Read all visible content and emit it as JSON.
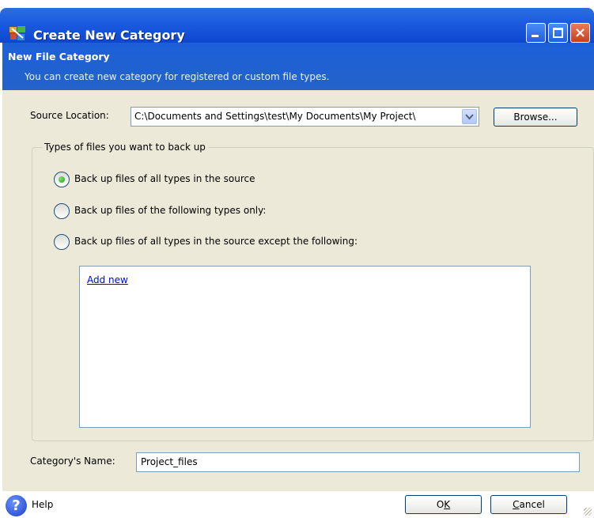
{
  "window": {
    "title": "Create New Category",
    "controls": {
      "minimize": "minimize",
      "maximize": "maximize",
      "close": "×"
    }
  },
  "header": {
    "title": "New File Category",
    "subtitle": "You can create new category for registered or custom file types."
  },
  "source": {
    "label": "Source Location:",
    "value": "C:\\Documents and Settings\\test\\My Documents\\My Project\\",
    "browse_label": "Browse..."
  },
  "filetypes": {
    "legend": "Types of files you want to back up",
    "options": [
      {
        "label": "Back up files of all types in the source",
        "selected": true
      },
      {
        "label": "Back up files of the following types only:",
        "selected": false
      },
      {
        "label": "Back up files of all types in the source except the following:",
        "selected": false
      }
    ],
    "list": {
      "add_link": "Add new"
    }
  },
  "category_name": {
    "label": "Category's Name:",
    "value": "Project_files"
  },
  "footer": {
    "help_label": "Help",
    "ok_label": "OK",
    "ok_mnemonic": "K",
    "cancel_label": "Cancel",
    "cancel_mnemonic": "C"
  },
  "icons": {
    "app": "category-app-icon",
    "dropdown": "chevron-down-icon",
    "help": "help-icon"
  },
  "colors": {
    "titlebar": "#0d47d0",
    "header_band": "#1d5fd8",
    "body_bg": "#ece9d8",
    "link": "#0000ff",
    "radio_selected": "#21a121"
  }
}
